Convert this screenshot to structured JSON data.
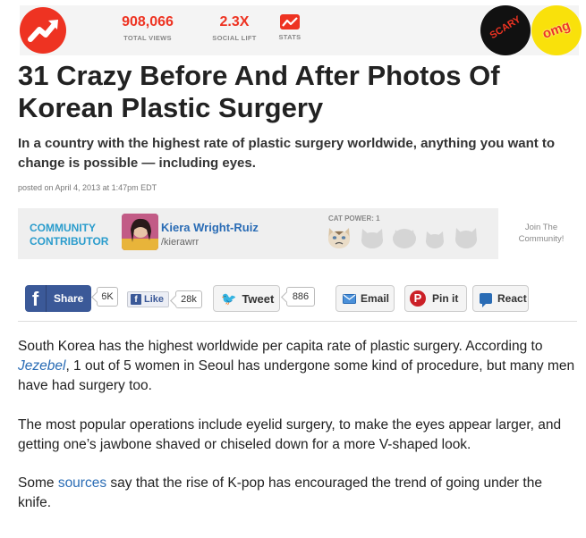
{
  "stats": {
    "views_value": "908,066",
    "views_label": "TOTAL VIEWS",
    "lift_value": "2.3X",
    "lift_label": "SOCIAL LIFT",
    "stats_label": "STATS"
  },
  "badges": {
    "scary": "SCARY",
    "omg": "omg"
  },
  "article": {
    "title": "31 Crazy Before And After Photos Of Korean Plastic Surgery",
    "description": "In a country with the highest rate of plastic surgery worldwide, anything you want to change is possible — including eyes.",
    "posted": "posted on April 4, 2013 at 1:47pm EDT"
  },
  "contributor": {
    "label_line1": "COMMUNITY",
    "label_line2": "CONTRIBUTOR",
    "name": "Kiera Wright-Ruiz",
    "handle": "/kierawrr",
    "cat_power_label": "CAT POWER: 1",
    "join_line1": "Join The",
    "join_line2": "Community!"
  },
  "share": {
    "fb_share": "Share",
    "fb_share_count": "6K",
    "fb_like": "Like",
    "fb_like_count": "28k",
    "tweet": "Tweet",
    "tweet_count": "886",
    "email": "Email",
    "pin": "Pin it",
    "react": "React"
  },
  "body": {
    "p1_a": "South Korea has the highest worldwide per capita rate of plastic surgery. According to ",
    "p1_link": "Jezebel",
    "p1_b": ", 1 out of 5 women in Seoul has undergone some kind of procedure, but many men have had surgery too.",
    "p2": "The most popular operations include eyelid surgery, to make the eyes appear larger, and getting one’s jawbone shaved or chiseled down for a more V-shaped look.",
    "p3_a": "Some ",
    "p3_link": "sources",
    "p3_b": " say that the rise of K-pop has encouraged the trend of going under the knife."
  },
  "colors": {
    "accent": "#ee3322",
    "link": "#2a6cb5",
    "contributor": "#2a9ccc",
    "facebook": "#3b5998"
  }
}
